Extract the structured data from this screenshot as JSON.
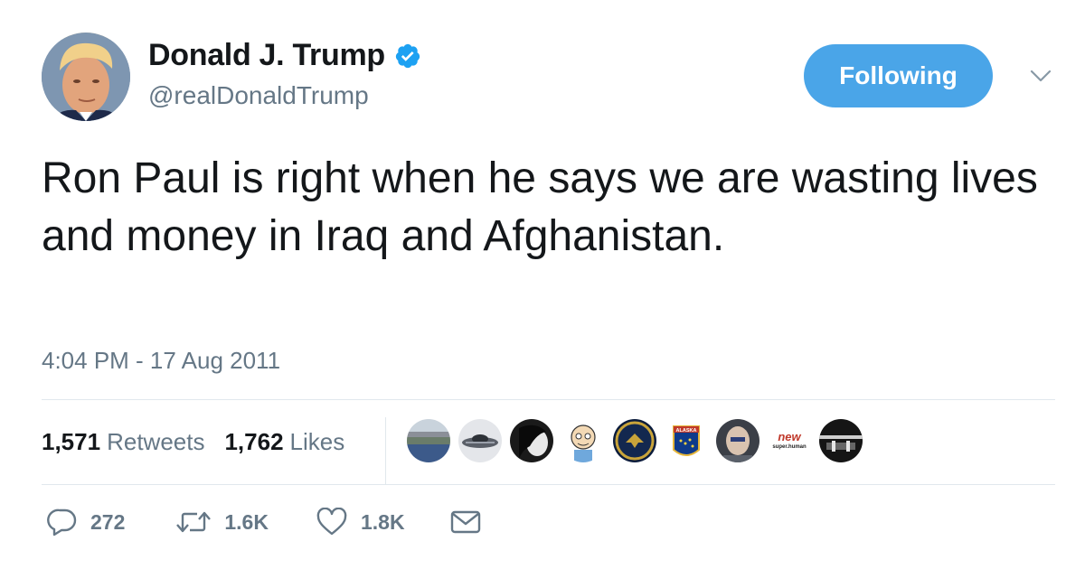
{
  "author": {
    "display_name": "Donald J. Trump",
    "handle": "@realDonaldTrump",
    "verified": true,
    "verified_color": "#1da1f2"
  },
  "follow_button": {
    "label": "Following",
    "color": "#4aa5e8"
  },
  "tweet": {
    "text": "Ron Paul is right when he says we are wasting lives and money in Iraq and Afghanistan.",
    "timestamp": "4:04 PM - 17 Aug 2011"
  },
  "stats": {
    "retweets_count": "1,571",
    "retweets_label": "Retweets",
    "likes_count": "1,762",
    "likes_label": "Likes"
  },
  "liker_avatars": [
    {
      "icon": "stadium-avatar"
    },
    {
      "icon": "spacecraft-avatar"
    },
    {
      "icon": "bw-portrait-avatar"
    },
    {
      "icon": "cartoon-avatar"
    },
    {
      "icon": "badge-emblem-avatar"
    },
    {
      "icon": "alaska-flag-avatar"
    },
    {
      "icon": "portrait-avatar"
    },
    {
      "icon": "new-superhuman-logo-avatar"
    },
    {
      "icon": "dark-landscape-avatar"
    }
  ],
  "liker_logo_text": {
    "line1": "new",
    "line2": "super.human"
  },
  "liker_badge_text": "ALASKA",
  "actions": {
    "reply_count": "272",
    "retweet_count": "1.6K",
    "like_count": "1.8K"
  },
  "colors": {
    "text_primary": "#14171a",
    "text_secondary": "#657786",
    "divider": "#e1e8ed",
    "icon": "#657786"
  }
}
